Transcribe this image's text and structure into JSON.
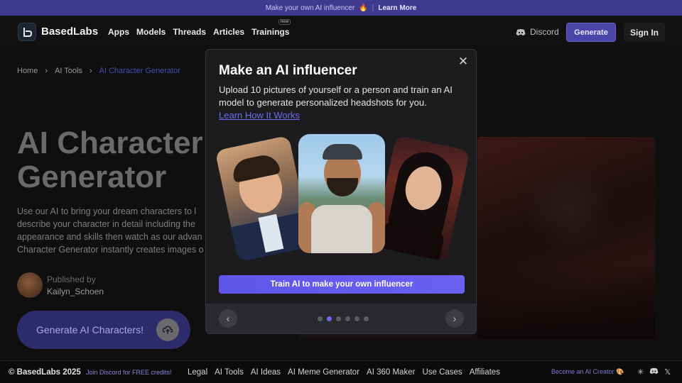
{
  "announcement": {
    "text": "Make your own AI influencer",
    "emoji": "🔥",
    "separator": "|",
    "link": "Learn More"
  },
  "header": {
    "logo_text": "BasedLabs",
    "nav": [
      {
        "label": "Apps"
      },
      {
        "label": "Models"
      },
      {
        "label": "Threads"
      },
      {
        "label": "Articles"
      },
      {
        "label": "Trainings",
        "badge": "new"
      }
    ],
    "discord_label": "Discord",
    "generate_label": "Generate",
    "signin_label": "Sign In"
  },
  "breadcrumb": {
    "items": [
      "Home",
      "AI Tools",
      "AI Character Generator"
    ],
    "separator": "›"
  },
  "hero": {
    "title_line1": "AI Character",
    "title_line2": "Generator",
    "desc_lines": [
      "Use our AI to bring your dream characters to l",
      "describe your character in detail including the",
      "appearance and skills then watch as our advan",
      "Character Generator instantly creates images o"
    ],
    "published_by": "Published by",
    "author": "Kailyn_Schoen",
    "cta": "Generate AI Characters!"
  },
  "modal": {
    "title": "Make an AI influencer",
    "description": "Upload 10 pictures of yourself or a person and train an AI model to generate personalized headshots for you.",
    "learn_link": "Learn How It Works",
    "train_button": "Train AI to make your own influencer",
    "carousel": {
      "total": 6,
      "active_index": 1
    }
  },
  "footer": {
    "copyright": "© BasedLabs 2025",
    "join": "Join Discord for FREE credits!",
    "links": [
      "Legal",
      "AI Tools",
      "AI Ideas",
      "AI Meme Generator",
      "AI 360 Maker",
      "Use Cases",
      "Affiliates"
    ],
    "creator": "Become an AI Creator",
    "creator_emoji": "🎨"
  },
  "colors": {
    "accent": "#6d68ef",
    "announce_bg": "#3f3a8f",
    "button": "#5f55e8"
  }
}
